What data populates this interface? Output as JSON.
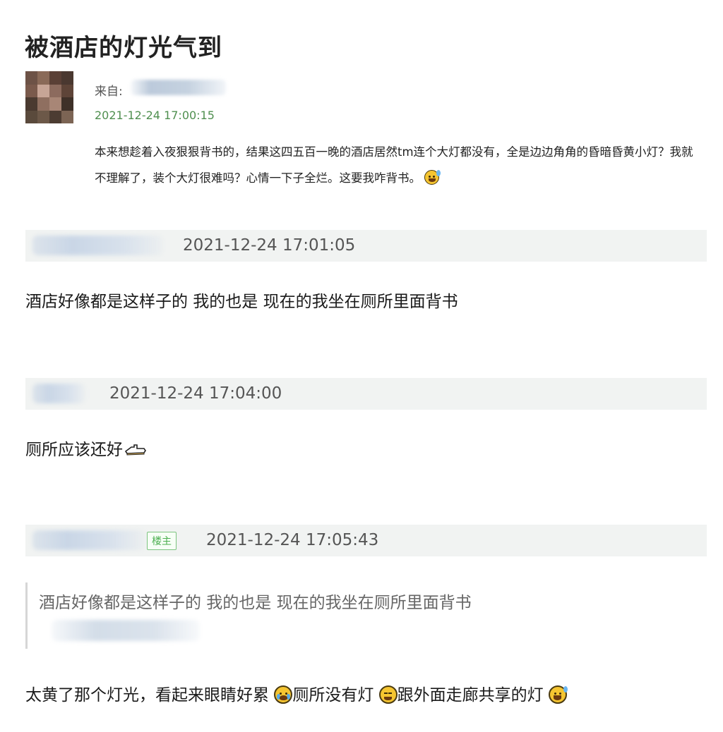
{
  "post": {
    "title": "被酒店的灯光气到",
    "from_label": "来自:",
    "time": "2021-12-24 17:00:15",
    "body": "本来想趁着入夜狠狠背书的，结果这四五百一晚的酒店居然tm连个大灯都没有，全是边边角角的昏暗昏黄小灯？我就不理解了，装个大灯很难吗？心情一下子全烂。这要我咋背书。"
  },
  "replies": [
    {
      "time": "2021-12-24 17:01:05",
      "text": "酒店好像都是这样子的 我的也是 现在的我坐在厕所里面背书"
    },
    {
      "time": "2021-12-24 17:04:00",
      "text": "厕所应该还好"
    },
    {
      "time": "2021-12-24 17:05:43",
      "badge": "楼主",
      "quote": "酒店好像都是这样子的 我的也是 现在的我坐在厕所里面背书",
      "text_parts": [
        "太黄了那个灯光，看起来眼睛好累",
        "厕所没有灯",
        "跟外面走廊共享的灯"
      ]
    }
  ],
  "icons": {
    "post_end": "grinning-sweat-emoji",
    "reply2_end": "pointing-hand-emoji",
    "reply3_a": "loudly-crying-emoji",
    "reply3_b": "smiling-face-emoji",
    "reply3_c": "grinning-sweat-emoji"
  },
  "colors": {
    "time_green": "#4f8f4f",
    "bar_bg": "#f1f3f2",
    "badge_green": "#4caf50",
    "emoji_yellow": "#f5c531"
  }
}
